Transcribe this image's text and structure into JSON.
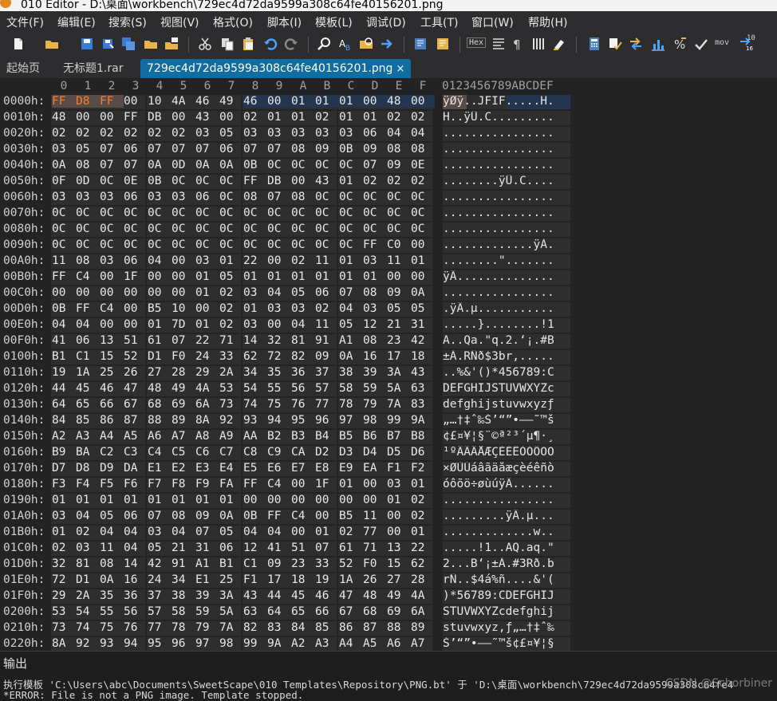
{
  "window": {
    "title": "010 Editor - D:\\桌面\\workbench\\729ec4d72da9599a308c64fe40156201.png"
  },
  "menu": [
    "文件(F)",
    "编辑(E)",
    "搜索(S)",
    "视图(V)",
    "格式(O)",
    "脚本(I)",
    "模板(L)",
    "调试(D)",
    "工具(T)",
    "窗口(W)",
    "帮助(H)"
  ],
  "toolbar": {
    "hex_label": "Hex",
    "mov_label": "mov",
    "tenbit_label": "10"
  },
  "tabs": {
    "start": "起始页",
    "untitled": "无标题1.rar",
    "active": "729ec4d72da9599a308c64fe40156201.png",
    "close_glyph": "×"
  },
  "ruler": {
    "cols": [
      "0",
      "1",
      "2",
      "3",
      "4",
      "5",
      "6",
      "7",
      "8",
      "9",
      "A",
      "B",
      "C",
      "D",
      "E",
      "F"
    ],
    "ascii_header": "0123456789ABCDEF"
  },
  "rows": [
    {
      "addr": "0000h:",
      "hex": [
        "FF",
        "D8",
        "FF",
        "00",
        "10",
        "4A",
        "46",
        "49",
        "46",
        "00",
        "01",
        "01",
        "01",
        "00",
        "48",
        "00"
      ],
      "ascii": "ÿØÿ..JFIF.....H."
    },
    {
      "addr": "0010h:",
      "hex": [
        "48",
        "00",
        "00",
        "FF",
        "DB",
        "00",
        "43",
        "00",
        "02",
        "01",
        "01",
        "02",
        "01",
        "01",
        "02",
        "02"
      ],
      "ascii": "H..ÿÛ.C........."
    },
    {
      "addr": "0020h:",
      "hex": [
        "02",
        "02",
        "02",
        "02",
        "02",
        "02",
        "03",
        "05",
        "03",
        "03",
        "03",
        "03",
        "03",
        "06",
        "04",
        "04"
      ],
      "ascii": "................"
    },
    {
      "addr": "0030h:",
      "hex": [
        "03",
        "05",
        "07",
        "06",
        "07",
        "07",
        "07",
        "06",
        "07",
        "07",
        "08",
        "09",
        "0B",
        "09",
        "08",
        "08"
      ],
      "ascii": "................"
    },
    {
      "addr": "0040h:",
      "hex": [
        "0A",
        "08",
        "07",
        "07",
        "0A",
        "0D",
        "0A",
        "0A",
        "0B",
        "0C",
        "0C",
        "0C",
        "0C",
        "07",
        "09",
        "0E"
      ],
      "ascii": "................"
    },
    {
      "addr": "0050h:",
      "hex": [
        "0F",
        "0D",
        "0C",
        "0E",
        "0B",
        "0C",
        "0C",
        "0C",
        "FF",
        "DB",
        "00",
        "43",
        "01",
        "02",
        "02",
        "02"
      ],
      "ascii": "........ÿÛ.C...."
    },
    {
      "addr": "0060h:",
      "hex": [
        "03",
        "03",
        "03",
        "06",
        "03",
        "03",
        "06",
        "0C",
        "08",
        "07",
        "08",
        "0C",
        "0C",
        "0C",
        "0C",
        "0C"
      ],
      "ascii": "................"
    },
    {
      "addr": "0070h:",
      "hex": [
        "0C",
        "0C",
        "0C",
        "0C",
        "0C",
        "0C",
        "0C",
        "0C",
        "0C",
        "0C",
        "0C",
        "0C",
        "0C",
        "0C",
        "0C",
        "0C"
      ],
      "ascii": "................"
    },
    {
      "addr": "0080h:",
      "hex": [
        "0C",
        "0C",
        "0C",
        "0C",
        "0C",
        "0C",
        "0C",
        "0C",
        "0C",
        "0C",
        "0C",
        "0C",
        "0C",
        "0C",
        "0C",
        "0C"
      ],
      "ascii": "................"
    },
    {
      "addr": "0090h:",
      "hex": [
        "0C",
        "0C",
        "0C",
        "0C",
        "0C",
        "0C",
        "0C",
        "0C",
        "0C",
        "0C",
        "0C",
        "0C",
        "0C",
        "FF",
        "C0",
        "00"
      ],
      "ascii": ".............ÿÀ."
    },
    {
      "addr": "00A0h:",
      "hex": [
        "11",
        "08",
        "03",
        "06",
        "04",
        "00",
        "03",
        "01",
        "22",
        "00",
        "02",
        "11",
        "01",
        "03",
        "11",
        "01"
      ],
      "ascii": "........\"......."
    },
    {
      "addr": "00B0h:",
      "hex": [
        "FF",
        "C4",
        "00",
        "1F",
        "00",
        "00",
        "01",
        "05",
        "01",
        "01",
        "01",
        "01",
        "01",
        "01",
        "00",
        "00"
      ],
      "ascii": "ÿÄ.............."
    },
    {
      "addr": "00C0h:",
      "hex": [
        "00",
        "00",
        "00",
        "00",
        "00",
        "00",
        "01",
        "02",
        "03",
        "04",
        "05",
        "06",
        "07",
        "08",
        "09",
        "0A"
      ],
      "ascii": "................"
    },
    {
      "addr": "00D0h:",
      "hex": [
        "0B",
        "FF",
        "C4",
        "00",
        "B5",
        "10",
        "00",
        "02",
        "01",
        "03",
        "03",
        "02",
        "04",
        "03",
        "05",
        "05"
      ],
      "ascii": ".ÿÄ.µ..........."
    },
    {
      "addr": "00E0h:",
      "hex": [
        "04",
        "04",
        "00",
        "00",
        "01",
        "7D",
        "01",
        "02",
        "03",
        "00",
        "04",
        "11",
        "05",
        "12",
        "21",
        "31"
      ],
      "ascii": ".....}........!1"
    },
    {
      "addr": "00F0h:",
      "hex": [
        "41",
        "06",
        "13",
        "51",
        "61",
        "07",
        "22",
        "71",
        "14",
        "32",
        "81",
        "91",
        "A1",
        "08",
        "23",
        "42"
      ],
      "ascii": "A..Qa.\"q.2.‘¡.#B"
    },
    {
      "addr": "0100h:",
      "hex": [
        "B1",
        "C1",
        "15",
        "52",
        "D1",
        "F0",
        "24",
        "33",
        "62",
        "72",
        "82",
        "09",
        "0A",
        "16",
        "17",
        "18"
      ],
      "ascii": "±Á.RÑð$3br,....."
    },
    {
      "addr": "0110h:",
      "hex": [
        "19",
        "1A",
        "25",
        "26",
        "27",
        "28",
        "29",
        "2A",
        "34",
        "35",
        "36",
        "37",
        "38",
        "39",
        "3A",
        "43"
      ],
      "ascii": "..%&'()*456789:C"
    },
    {
      "addr": "0120h:",
      "hex": [
        "44",
        "45",
        "46",
        "47",
        "48",
        "49",
        "4A",
        "53",
        "54",
        "55",
        "56",
        "57",
        "58",
        "59",
        "5A",
        "63"
      ],
      "ascii": "DEFGHIJSTUVWXYZc"
    },
    {
      "addr": "0130h:",
      "hex": [
        "64",
        "65",
        "66",
        "67",
        "68",
        "69",
        "6A",
        "73",
        "74",
        "75",
        "76",
        "77",
        "78",
        "79",
        "7A",
        "83"
      ],
      "ascii": "defghijstuvwxyzƒ"
    },
    {
      "addr": "0140h:",
      "hex": [
        "84",
        "85",
        "86",
        "87",
        "88",
        "89",
        "8A",
        "92",
        "93",
        "94",
        "95",
        "96",
        "97",
        "98",
        "99",
        "9A"
      ],
      "ascii": "„…†‡ˆ‰Š’“”•–—˜™š"
    },
    {
      "addr": "0150h:",
      "hex": [
        "A2",
        "A3",
        "A4",
        "A5",
        "A6",
        "A7",
        "A8",
        "A9",
        "AA",
        "B2",
        "B3",
        "B4",
        "B5",
        "B6",
        "B7",
        "B8"
      ],
      "ascii": "¢£¤¥¦§¨©ª²³´µ¶·¸"
    },
    {
      "addr": "0160h:",
      "hex": [
        "B9",
        "BA",
        "C2",
        "C3",
        "C4",
        "C5",
        "C6",
        "C7",
        "C8",
        "C9",
        "CA",
        "D2",
        "D3",
        "D4",
        "D5",
        "D6"
      ],
      "ascii": "¹ºÂÃÄÅÆÇÈÉÊÒÓÔÕÖ"
    },
    {
      "addr": "0170h:",
      "hex": [
        "D7",
        "D8",
        "D9",
        "DA",
        "E1",
        "E2",
        "E3",
        "E4",
        "E5",
        "E6",
        "E7",
        "E8",
        "E9",
        "EA",
        "F1",
        "F2"
      ],
      "ascii": "×ØÙÚáâãäåæçèéêñò"
    },
    {
      "addr": "0180h:",
      "hex": [
        "F3",
        "F4",
        "F5",
        "F6",
        "F7",
        "F8",
        "F9",
        "FA",
        "FF",
        "C4",
        "00",
        "1F",
        "01",
        "00",
        "03",
        "01"
      ],
      "ascii": "óôõö÷øùúÿÄ......"
    },
    {
      "addr": "0190h:",
      "hex": [
        "01",
        "01",
        "01",
        "01",
        "01",
        "01",
        "01",
        "01",
        "00",
        "00",
        "00",
        "00",
        "00",
        "00",
        "01",
        "02"
      ],
      "ascii": "................"
    },
    {
      "addr": "01A0h:",
      "hex": [
        "03",
        "04",
        "05",
        "06",
        "07",
        "08",
        "09",
        "0A",
        "0B",
        "FF",
        "C4",
        "00",
        "B5",
        "11",
        "00",
        "02"
      ],
      "ascii": ".........ÿÄ.µ..."
    },
    {
      "addr": "01B0h:",
      "hex": [
        "01",
        "02",
        "04",
        "04",
        "03",
        "04",
        "07",
        "05",
        "04",
        "04",
        "00",
        "01",
        "02",
        "77",
        "00",
        "01"
      ],
      "ascii": ".............w.."
    },
    {
      "addr": "01C0h:",
      "hex": [
        "02",
        "03",
        "11",
        "04",
        "05",
        "21",
        "31",
        "06",
        "12",
        "41",
        "51",
        "07",
        "61",
        "71",
        "13",
        "22"
      ],
      "ascii": ".....!1..AQ.aq.\""
    },
    {
      "addr": "01D0h:",
      "hex": [
        "32",
        "81",
        "08",
        "14",
        "42",
        "91",
        "A1",
        "B1",
        "C1",
        "09",
        "23",
        "33",
        "52",
        "F0",
        "15",
        "62"
      ],
      "ascii": "2...B‘¡±Á.#3Rð.b"
    },
    {
      "addr": "01E0h:",
      "hex": [
        "72",
        "D1",
        "0A",
        "16",
        "24",
        "34",
        "E1",
        "25",
        "F1",
        "17",
        "18",
        "19",
        "1A",
        "26",
        "27",
        "28"
      ],
      "ascii": "rÑ..$4á%ñ....&'("
    },
    {
      "addr": "01F0h:",
      "hex": [
        "29",
        "2A",
        "35",
        "36",
        "37",
        "38",
        "39",
        "3A",
        "43",
        "44",
        "45",
        "46",
        "47",
        "48",
        "49",
        "4A"
      ],
      "ascii": ")*56789:CDEFGHIJ"
    },
    {
      "addr": "0200h:",
      "hex": [
        "53",
        "54",
        "55",
        "56",
        "57",
        "58",
        "59",
        "5A",
        "63",
        "64",
        "65",
        "66",
        "67",
        "68",
        "69",
        "6A"
      ],
      "ascii": "STUVWXYZcdefghij"
    },
    {
      "addr": "0210h:",
      "hex": [
        "73",
        "74",
        "75",
        "76",
        "77",
        "78",
        "79",
        "7A",
        "82",
        "83",
        "84",
        "85",
        "86",
        "87",
        "88",
        "89"
      ],
      "ascii": "stuvwxyz‚ƒ„…†‡ˆ‰"
    },
    {
      "addr": "0220h:",
      "hex": [
        "8A",
        "92",
        "93",
        "94",
        "95",
        "96",
        "97",
        "98",
        "99",
        "9A",
        "A2",
        "A3",
        "A4",
        "A5",
        "A6",
        "A7"
      ],
      "ascii": "Š’“”•–—˜™š¢£¤¥¦§"
    }
  ],
  "output": {
    "title": "输出",
    "line1": "执行模板 'C:\\Users\\abc\\Documents\\SweetScape\\010 Templates\\Repository\\PNG.bt' 于 'D:\\桌面\\workbench\\729ec4d72da9599a308c64fe4",
    "line2": "*ERROR: File is not a PNG image. Template stopped.",
    "watermark": "CSDN @Schorbiner"
  }
}
